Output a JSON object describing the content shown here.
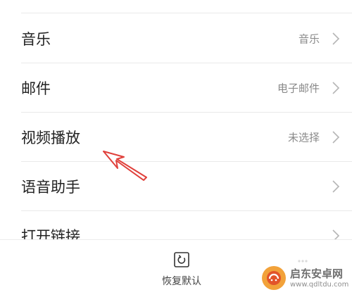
{
  "settings_list": {
    "rows": [
      {
        "label": "音乐",
        "value": "音乐"
      },
      {
        "label": "邮件",
        "value": "电子邮件"
      },
      {
        "label": "视频播放",
        "value": "未选择"
      },
      {
        "label": "语音助手",
        "value": ""
      },
      {
        "label": "打开链接",
        "value": ""
      }
    ],
    "chevron_icon": "chevron-right-icon"
  },
  "annotation": {
    "arrow_color": "#e0403b",
    "points_to": "视频播放"
  },
  "bottom_bar": {
    "reset_label": "恢复默认",
    "reset_icon": "restore-icon"
  },
  "watermark": {
    "name": "启东安卓网",
    "url": "www.qdltdu.com",
    "logo_color": "#f2a23a"
  }
}
